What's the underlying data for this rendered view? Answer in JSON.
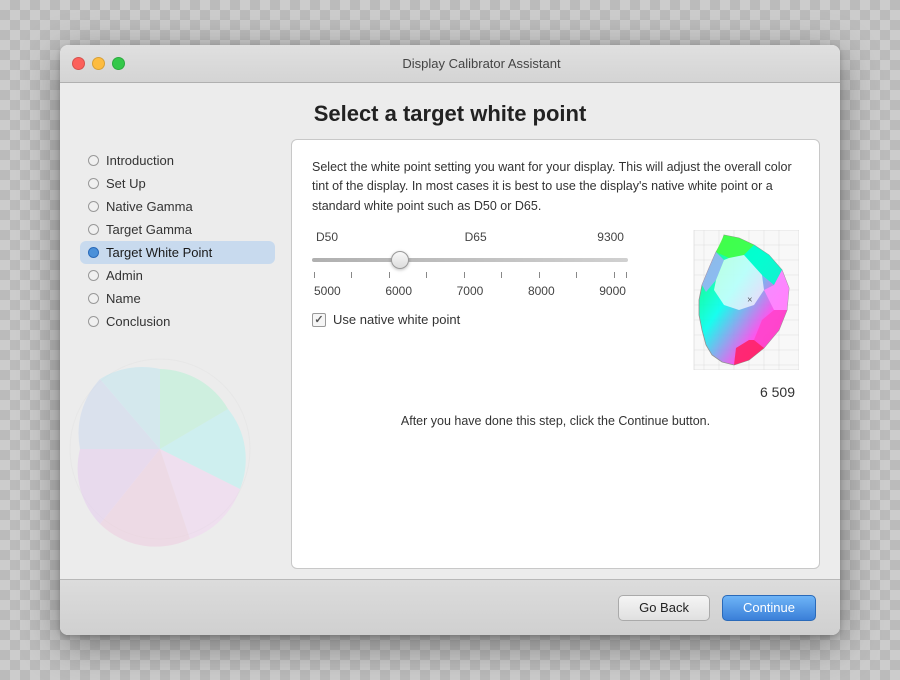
{
  "window": {
    "title": "Display Calibrator Assistant",
    "page_title": "Select a target white point"
  },
  "traffic_lights": {
    "close": "close",
    "minimize": "minimize",
    "maximize": "maximize"
  },
  "sidebar": {
    "items": [
      {
        "id": "introduction",
        "label": "Introduction",
        "active": false
      },
      {
        "id": "setup",
        "label": "Set Up",
        "active": false
      },
      {
        "id": "native-gamma",
        "label": "Native Gamma",
        "active": false
      },
      {
        "id": "target-gamma",
        "label": "Target Gamma",
        "active": false
      },
      {
        "id": "target-white-point",
        "label": "Target White Point",
        "active": true
      },
      {
        "id": "admin",
        "label": "Admin",
        "active": false
      },
      {
        "id": "name",
        "label": "Name",
        "active": false
      },
      {
        "id": "conclusion",
        "label": "Conclusion",
        "active": false
      }
    ]
  },
  "main": {
    "description": "Select the white point setting you want for your display.  This will adjust the overall color tint of the display.  In most cases it is best to use the display's native white point or a standard white point such as D50 or D65.",
    "slider": {
      "label_d50": "D50",
      "label_d65": "D65",
      "label_9300": "9300",
      "tick_labels": [
        "5000",
        "6000",
        "7000",
        "8000",
        "9000"
      ]
    },
    "checkbox_label": "Use native white point",
    "value_display": "6 509",
    "after_step_text": "After you have done this step, click the Continue button."
  },
  "footer": {
    "go_back_label": "Go Back",
    "continue_label": "Continue"
  }
}
